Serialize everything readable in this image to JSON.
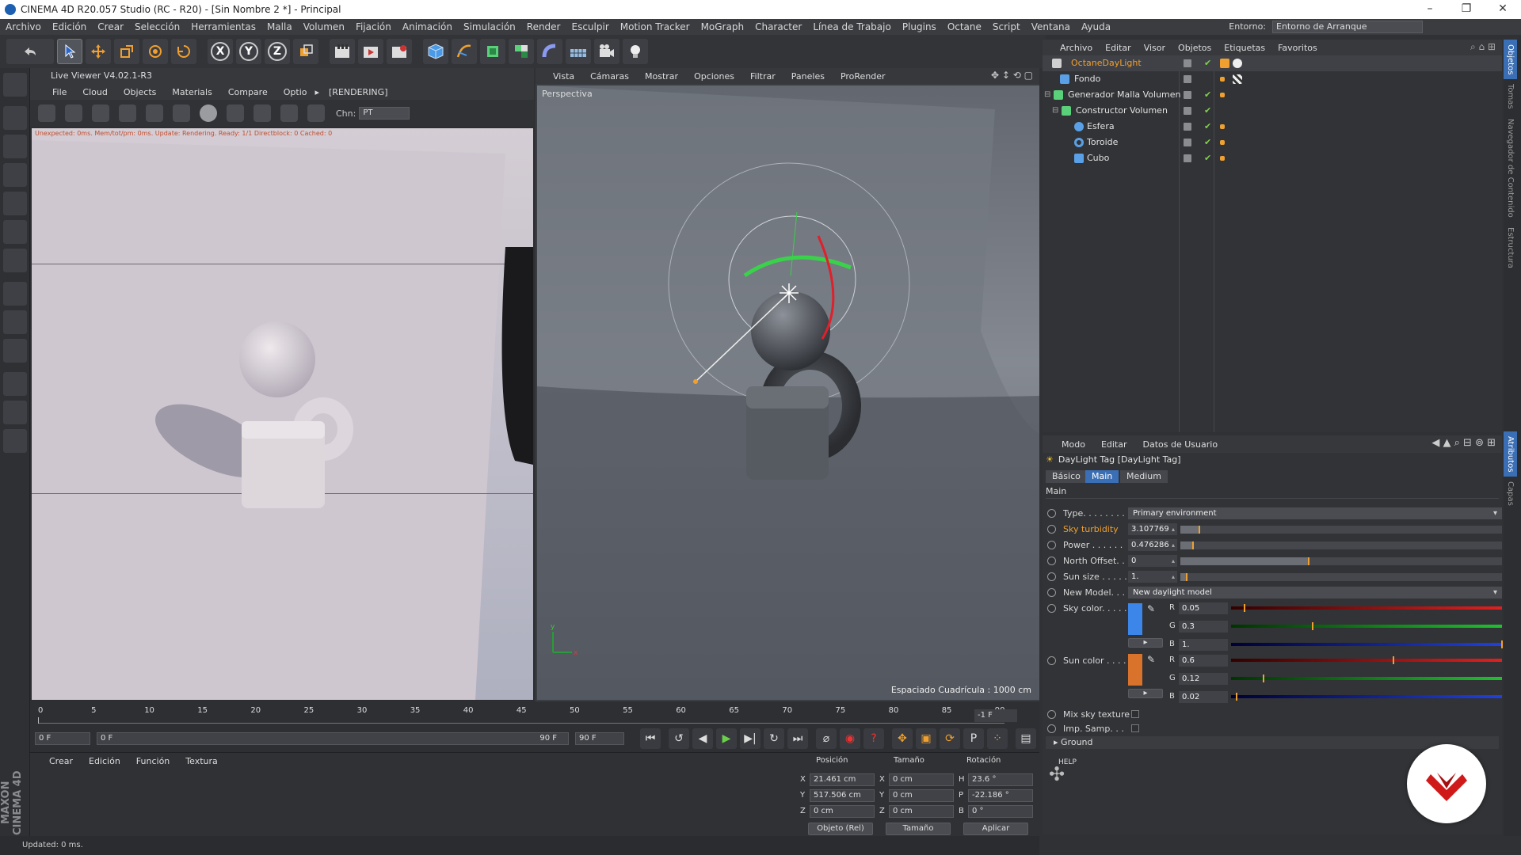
{
  "window": {
    "title": "CINEMA 4D R20.057 Studio (RC - R20) - [Sin Nombre 2 *] - Principal",
    "minimize": "–",
    "restore": "❐",
    "close": "✕"
  },
  "menubar": {
    "items": [
      "Archivo",
      "Edición",
      "Crear",
      "Selección",
      "Herramientas",
      "Malla",
      "Volumen",
      "Fijación",
      "Animación",
      "Simulación",
      "Render",
      "Esculpir",
      "Motion Tracker",
      "MoGraph",
      "Character",
      "Línea de Trabajo",
      "Plugins",
      "Octane",
      "Script",
      "Ventana",
      "Ayuda"
    ],
    "env_label": "Entorno:",
    "env_value": "Entorno de Arranque"
  },
  "toolbar": {
    "axis_x": "X",
    "axis_y": "Y",
    "axis_z": "Z"
  },
  "live_viewer": {
    "title": "Live Viewer V4.02.1-R3",
    "menu": [
      "File",
      "Cloud",
      "Objects",
      "Materials",
      "Compare",
      "Optio"
    ],
    "menu_more": "▸",
    "status_tag": "[RENDERING]",
    "chn_label": "Chn:",
    "chn_value": "PT",
    "render_status": "Unexpected: 0ms. Mem/tot/pm: 0ms. Update: Rendering. Ready: 1/1 Directblock: 0 Cached: 0"
  },
  "viewport": {
    "menu": [
      "Vista",
      "Cámaras",
      "Mostrar",
      "Opciones",
      "Filtrar",
      "Paneles",
      "ProRender"
    ],
    "label": "Perspectiva",
    "grid_spacing": "Espaciado Cuadrícula : 1000 cm"
  },
  "timeline": {
    "ticks": [
      "0",
      "5",
      "10",
      "15",
      "20",
      "25",
      "30",
      "35",
      "40",
      "45",
      "50",
      "55",
      "60",
      "65",
      "70",
      "75",
      "80",
      "85",
      "90"
    ],
    "frame_end_readout": "-1 F",
    "start_field": "0 F",
    "range_start": "0 F",
    "range_end": "90 F",
    "end_field": "90 F",
    "max_field": "90 F",
    "current_frame": 0
  },
  "materials": {
    "menu": [
      "Crear",
      "Edición",
      "Función",
      "Textura"
    ]
  },
  "coordinates": {
    "headers": {
      "position": "Posición",
      "size": "Tamaño",
      "rotation": "Rotación"
    },
    "rows": [
      {
        "axis": "X",
        "pos": "21.461 cm",
        "size_axis": "X",
        "size": "0 cm",
        "rot_axis": "H",
        "rot": "23.6 °"
      },
      {
        "axis": "Y",
        "pos": "517.506 cm",
        "size_axis": "Y",
        "size": "0 cm",
        "rot_axis": "P",
        "rot": "-22.186 °"
      },
      {
        "axis": "Z",
        "pos": "0 cm",
        "size_axis": "Z",
        "size": "0 cm",
        "rot_axis": "B",
        "rot": "0 °"
      }
    ],
    "mode_select": "Objeto (Rel)",
    "size_select": "Tamaño",
    "apply": "Aplicar"
  },
  "statusbar": {
    "text": "Updated: 0 ms.",
    "brand": "MAXON CINEMA 4D"
  },
  "object_manager": {
    "menu": [
      "Archivo",
      "Editar",
      "Visor",
      "Objetos",
      "Etiquetas",
      "Favoritos"
    ],
    "objects": [
      {
        "name": "OctaneDayLight",
        "selected": true,
        "icon_color": "#d0d0d0"
      },
      {
        "name": "Fondo",
        "selected": false,
        "icon_color": "#5aa0e6"
      },
      {
        "name": "Generador Malla Volumen",
        "selected": false,
        "icon_color": "#5ad07a"
      },
      {
        "name": "Constructor Volumen",
        "selected": false,
        "icon_color": "#5ad07a"
      },
      {
        "name": "Esfera",
        "selected": false,
        "icon_color": "#5aa0e6"
      },
      {
        "name": "Toroide",
        "selected": false,
        "icon_color": "#5aa0e6"
      },
      {
        "name": "Cubo",
        "selected": false,
        "icon_color": "#5aa0e6"
      }
    ]
  },
  "attribute_manager": {
    "menu": [
      "Modo",
      "Editar",
      "Datos de Usuario"
    ],
    "title": "DayLight Tag [DayLight Tag]",
    "tabs": [
      "Básico",
      "Main",
      "Medium"
    ],
    "active_tab": "Main",
    "section": "Main",
    "type_label": "Type. . . . . . . .",
    "type_value": "Primary environment",
    "sky_turbidity_label": "Sky turbidity",
    "sky_turbidity_value": "3.107769",
    "sky_turbidity_level": 0.06,
    "power_label": "Power . . . . . .",
    "power_value": "0.476286",
    "power_level": 0.04,
    "north_offset_label": "North Offset. .",
    "north_offset_value": "0",
    "north_offset_level": 0.4,
    "sun_size_label": "Sun size . . . . .",
    "sun_size_value": "1.",
    "sun_size_level": 0.02,
    "new_model_label": "New Model. . .",
    "new_model_value": "New daylight model",
    "sky_color_label": "Sky color. . . . .",
    "sky_color": {
      "hex": "#3b86e8",
      "R": "0.05",
      "G": "0.3",
      "B": "1.",
      "r_level": 0.05,
      "g_level": 0.3,
      "b_level": 1.0
    },
    "sun_color_label": "Sun color . . . .",
    "sun_color": {
      "hex": "#d9722a",
      "R": "0.6",
      "G": "0.12",
      "B": "0.02",
      "r_level": 0.6,
      "g_level": 0.12,
      "b_level": 0.02
    },
    "channel_labels": [
      "R",
      "G",
      "B"
    ],
    "mix_sky_label": "Mix sky texture",
    "imp_samp_label": "Imp. Samp. . .",
    "ground_label": "Ground",
    "help_label": "HELP"
  },
  "right_tabs": [
    "Objetos",
    "Tomas",
    "Navegador de Contenido",
    "Estructura",
    "Atributos",
    "Capas"
  ]
}
